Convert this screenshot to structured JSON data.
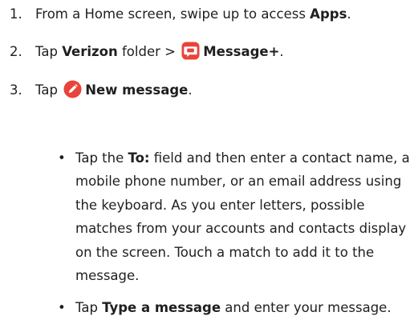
{
  "steps": [
    {
      "number": "1.",
      "text_before": "From a Home screen, swipe up to access ",
      "bold": "Apps",
      "text_after": "."
    },
    {
      "number": "2.",
      "text_before": "Tap ",
      "bold_folder": "Verizon",
      "middle": " folder > ",
      "icon": "message-plus-app-icon",
      "bold_app": "Message+",
      "text_after": "."
    },
    {
      "number": "3.",
      "text_before": "Tap ",
      "icon": "new-message-pencil-icon",
      "bold": "New message",
      "text_after": "."
    }
  ],
  "bullets": [
    {
      "text_before": "Tap the ",
      "bold": "To:",
      "text_after": " field and then enter a contact name, a mobile phone number, or an email address using the keyboard. As you enter letters, possible matches from your accounts and contacts display on the screen. Touch a match to add it to the message."
    },
    {
      "text_before": "Tap ",
      "bold": "Type a message",
      "text_after": " and enter your message."
    }
  ],
  "colors": {
    "text": "#1f1f1f",
    "message_plus_icon": "#e8443a",
    "new_message_icon": "#e8443a"
  }
}
